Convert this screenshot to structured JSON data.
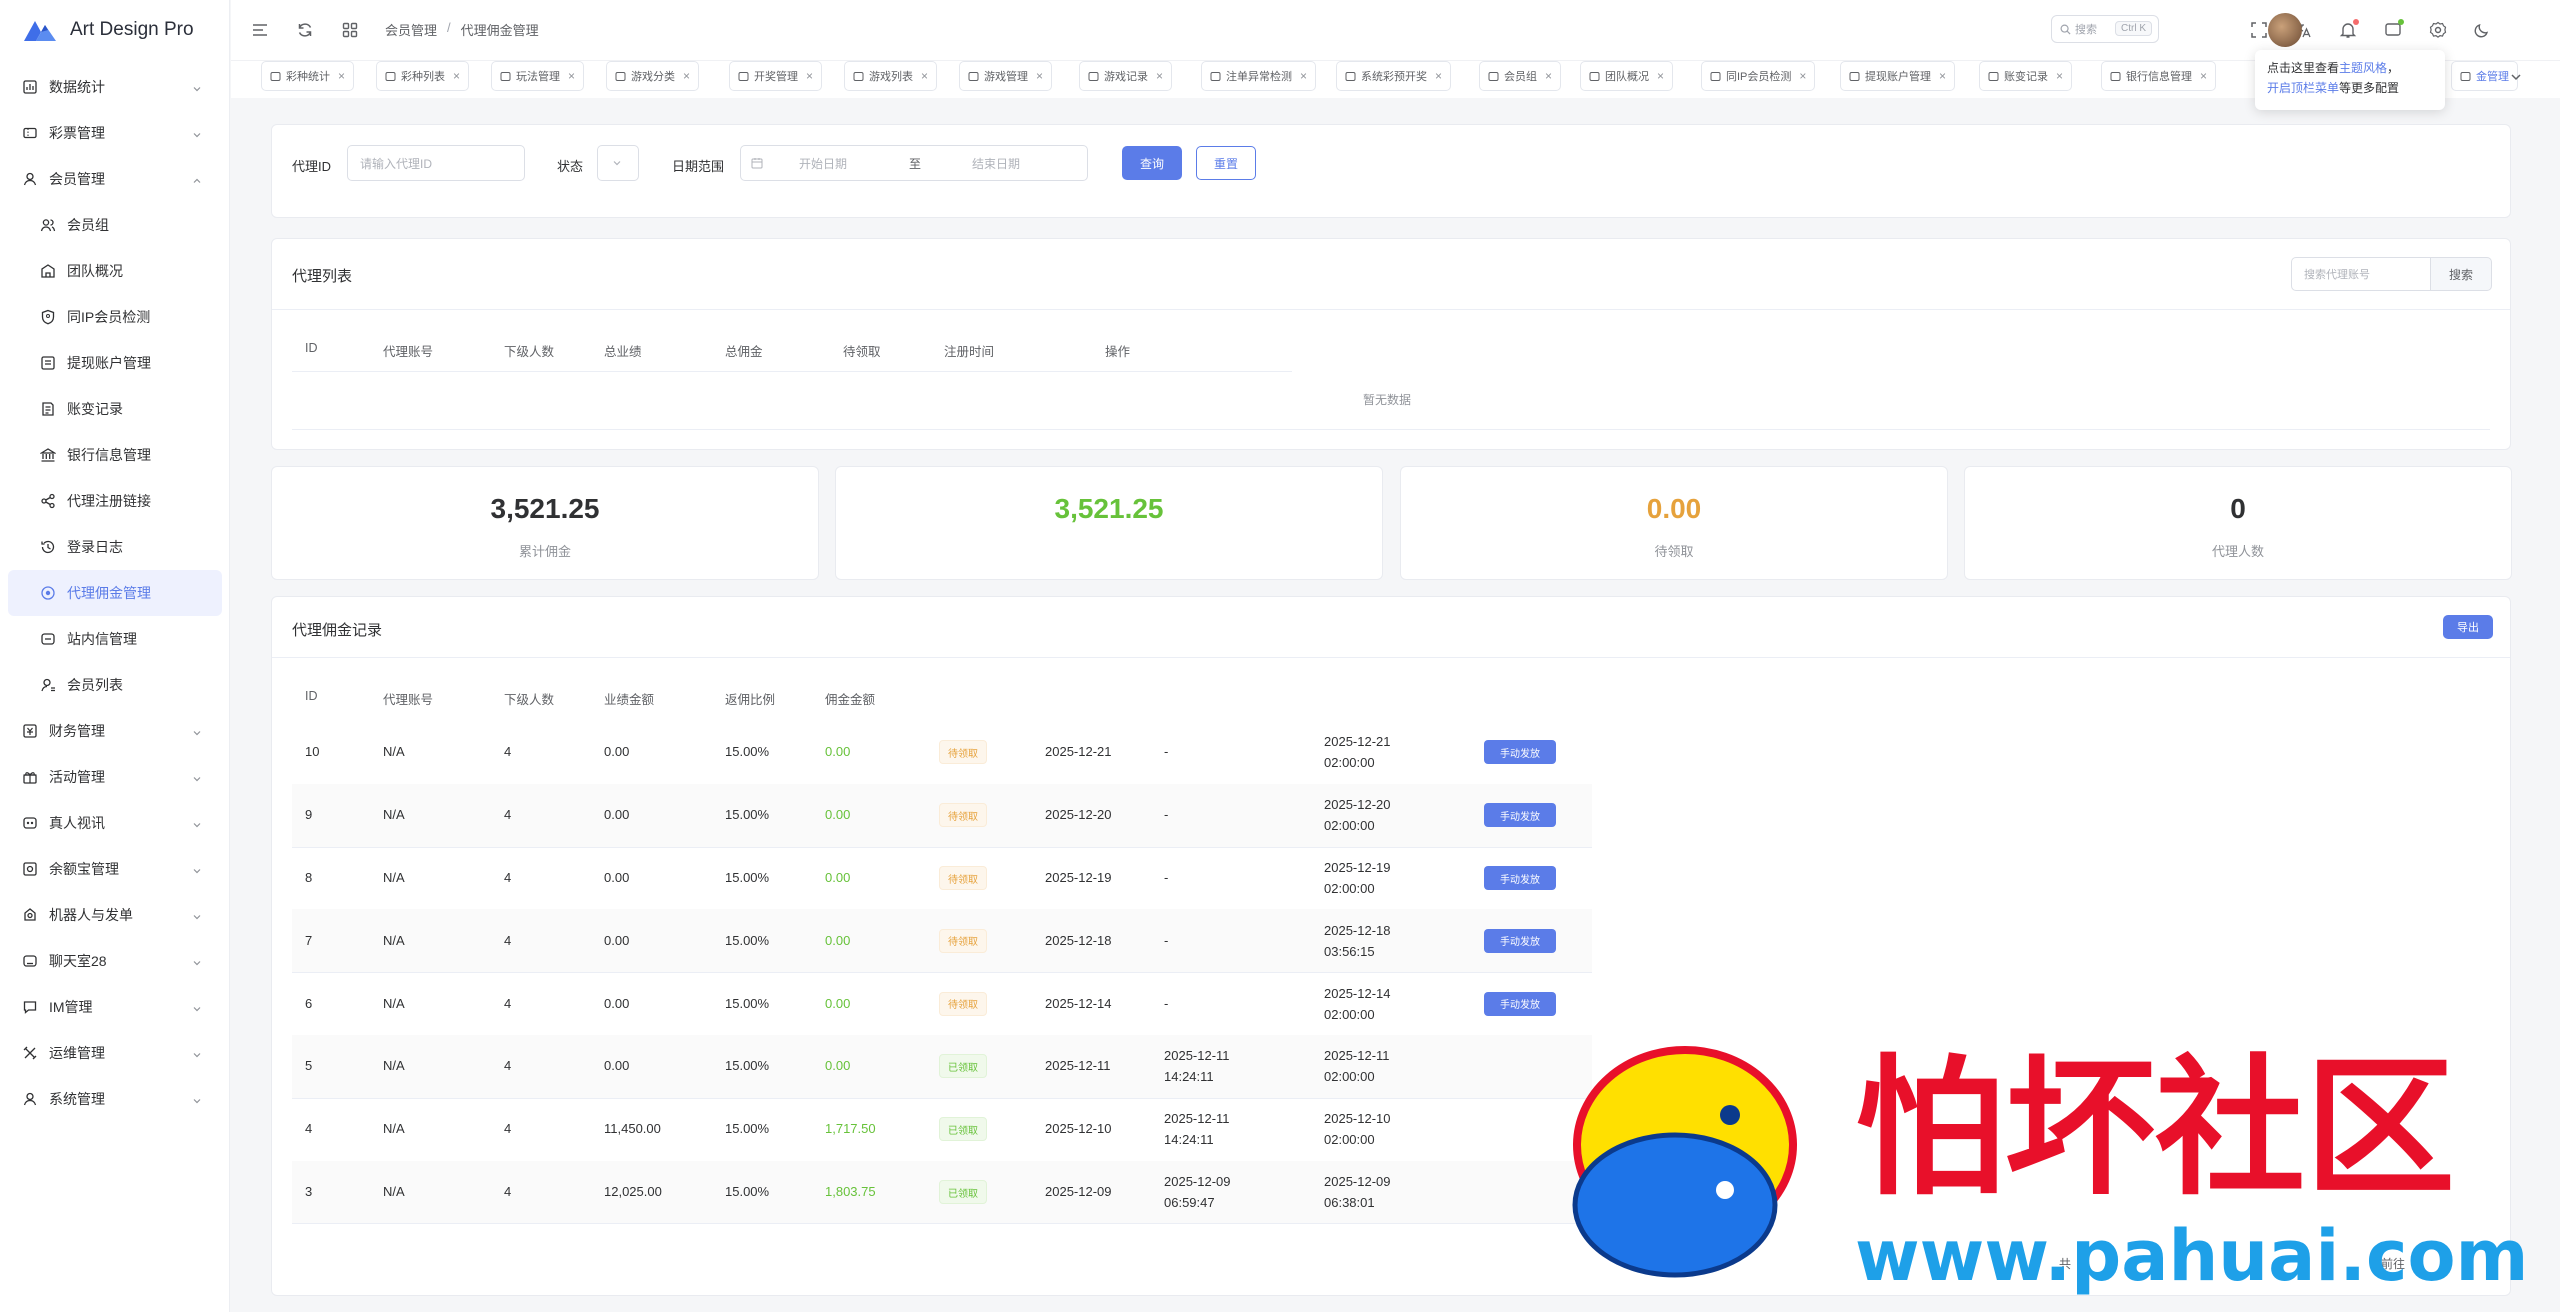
{
  "app": {
    "name": "Art Design Pro"
  },
  "sidebar": {
    "items": [
      {
        "label": "数据统计",
        "icon": "chart-icon",
        "kind": "top"
      },
      {
        "label": "彩票管理",
        "icon": "ticket-icon",
        "kind": "top"
      },
      {
        "label": "会员管理",
        "icon": "user-icon",
        "kind": "top-open"
      },
      {
        "label": "会员组",
        "icon": "users-icon",
        "kind": "sub"
      },
      {
        "label": "团队概况",
        "icon": "team-icon",
        "kind": "sub"
      },
      {
        "label": "同IP会员检测",
        "icon": "shield-icon",
        "kind": "sub"
      },
      {
        "label": "提现账户管理",
        "icon": "wallet-icon",
        "kind": "sub"
      },
      {
        "label": "账变记录",
        "icon": "record-icon",
        "kind": "sub"
      },
      {
        "label": "银行信息管理",
        "icon": "bank-icon",
        "kind": "sub"
      },
      {
        "label": "代理注册链接",
        "icon": "share-icon",
        "kind": "sub"
      },
      {
        "label": "登录日志",
        "icon": "history-icon",
        "kind": "sub"
      },
      {
        "label": "代理佣金管理",
        "icon": "commission-icon",
        "kind": "sub-active"
      },
      {
        "label": "站内信管理",
        "icon": "message-icon",
        "kind": "sub"
      },
      {
        "label": "会员列表",
        "icon": "user-list-icon",
        "kind": "sub"
      },
      {
        "label": "财务管理",
        "icon": "finance-icon",
        "kind": "top"
      },
      {
        "label": "活动管理",
        "icon": "gift-icon",
        "kind": "top"
      },
      {
        "label": "真人视讯",
        "icon": "video-icon",
        "kind": "top"
      },
      {
        "label": "余额宝管理",
        "icon": "coin-icon",
        "kind": "top"
      },
      {
        "label": "机器人与发单",
        "icon": "robot-icon",
        "kind": "top"
      },
      {
        "label": "聊天室28",
        "icon": "chat-icon",
        "kind": "top"
      },
      {
        "label": "IM管理",
        "icon": "im-icon",
        "kind": "top"
      },
      {
        "label": "运维管理",
        "icon": "tools-icon",
        "kind": "top"
      },
      {
        "label": "系统管理",
        "icon": "system-icon",
        "kind": "top"
      }
    ]
  },
  "header": {
    "breadcrumb": [
      "会员管理",
      "代理佣金管理"
    ],
    "breadcrumb_sep": "/",
    "search_placeholder": "搜索",
    "search_kbd": "Ctrl K"
  },
  "tabs": [
    {
      "label": "彩种统计"
    },
    {
      "label": "彩种列表"
    },
    {
      "label": "玩法管理"
    },
    {
      "label": "游戏分类"
    },
    {
      "label": "开奖管理"
    },
    {
      "label": "游戏列表"
    },
    {
      "label": "游戏管理"
    },
    {
      "label": "游戏记录"
    },
    {
      "label": "注单异常检测"
    },
    {
      "label": "系统彩预开奖"
    },
    {
      "label": "会员组"
    },
    {
      "label": "团队概况"
    },
    {
      "label": "同IP会员检测"
    },
    {
      "label": "提现账户管理"
    },
    {
      "label": "账变记录"
    },
    {
      "label": "银行信息管理"
    },
    {
      "label": "金管理"
    }
  ],
  "tab_close": "×",
  "tooltip": {
    "prefix": "点击这里查看",
    "link1": "主题风格",
    "mid": "，",
    "link2": "开启顶栏菜单",
    "suffix": "等更多配置"
  },
  "filter": {
    "agent_id_label": "代理ID",
    "agent_id_placeholder": "请输入代理ID",
    "status_label": "状态",
    "date_label": "日期范围",
    "start_placeholder": "开始日期",
    "range_sep": "至",
    "end_placeholder": "结束日期",
    "query_button": "查询",
    "reset_button": "重置"
  },
  "agent_list": {
    "title": "代理列表",
    "search_placeholder": "搜索代理账号",
    "search_button": "搜索",
    "columns": [
      "ID",
      "代理账号",
      "下级人数",
      "总业绩",
      "总佣金",
      "待领取",
      "注册时间",
      "操作"
    ],
    "empty": "暂无数据"
  },
  "stats": [
    {
      "value": "3,521.25",
      "label": "累计佣金",
      "color": "#303133"
    },
    {
      "value": "3,521.25",
      "label": "",
      "color": "#67c23a"
    },
    {
      "value": "0.00",
      "label": "待领取",
      "color": "#e6a23c"
    },
    {
      "value": "0",
      "label": "代理人数",
      "color": "#303133"
    }
  ],
  "records": {
    "title": "代理佣金记录",
    "export_button": "导出",
    "columns": [
      "ID",
      "代理账号",
      "下级人数",
      "业绩金额",
      "返佣比例",
      "佣金金额"
    ],
    "rows": [
      {
        "id": "10",
        "account": "N/A",
        "subs": "4",
        "amount": "0.00",
        "rate": "15.00%",
        "commission": "0.00",
        "status": "待领取",
        "status_type": "wait",
        "date": "2025-12-21",
        "claim1": "-",
        "claim2": "",
        "created1": "2025-12-21",
        "created2": "02:00:00",
        "action": "手动发放"
      },
      {
        "id": "9",
        "account": "N/A",
        "subs": "4",
        "amount": "0.00",
        "rate": "15.00%",
        "commission": "0.00",
        "status": "待领取",
        "status_type": "wait",
        "date": "2025-12-20",
        "claim1": "-",
        "claim2": "",
        "created1": "2025-12-20",
        "created2": "02:00:00",
        "action": "手动发放"
      },
      {
        "id": "8",
        "account": "N/A",
        "subs": "4",
        "amount": "0.00",
        "rate": "15.00%",
        "commission": "0.00",
        "status": "待领取",
        "status_type": "wait",
        "date": "2025-12-19",
        "claim1": "-",
        "claim2": "",
        "created1": "2025-12-19",
        "created2": "02:00:00",
        "action": "手动发放"
      },
      {
        "id": "7",
        "account": "N/A",
        "subs": "4",
        "amount": "0.00",
        "rate": "15.00%",
        "commission": "0.00",
        "status": "待领取",
        "status_type": "wait",
        "date": "2025-12-18",
        "claim1": "-",
        "claim2": "",
        "created1": "2025-12-18",
        "created2": "03:56:15",
        "action": "手动发放"
      },
      {
        "id": "6",
        "account": "N/A",
        "subs": "4",
        "amount": "0.00",
        "rate": "15.00%",
        "commission": "0.00",
        "status": "待领取",
        "status_type": "wait",
        "date": "2025-12-14",
        "claim1": "-",
        "claim2": "",
        "created1": "2025-12-14",
        "created2": "02:00:00",
        "action": "手动发放"
      },
      {
        "id": "5",
        "account": "N/A",
        "subs": "4",
        "amount": "0.00",
        "rate": "15.00%",
        "commission": "0.00",
        "status": "已领取",
        "status_type": "done",
        "date": "2025-12-11",
        "claim1": "2025-12-11",
        "claim2": "14:24:11",
        "created1": "2025-12-11",
        "created2": "02:00:00",
        "action": ""
      },
      {
        "id": "4",
        "account": "N/A",
        "subs": "4",
        "amount": "11,450.00",
        "rate": "15.00%",
        "commission": "1,717.50",
        "status": "已领取",
        "status_type": "done",
        "date": "2025-12-10",
        "claim1": "2025-12-11",
        "claim2": "14:24:11",
        "created1": "2025-12-10",
        "created2": "02:00:00",
        "action": ""
      },
      {
        "id": "3",
        "account": "N/A",
        "subs": "4",
        "amount": "12,025.00",
        "rate": "15.00%",
        "commission": "1,803.75",
        "status": "已领取",
        "status_type": "done",
        "date": "2025-12-09",
        "claim1": "2025-12-09",
        "claim2": "06:59:47",
        "created1": "2025-12-09",
        "created2": "06:38:01",
        "action": ""
      }
    ],
    "pager": {
      "total_prefix": "共",
      "goto": "前往"
    }
  },
  "watermark": {
    "cn": "怕坏社区",
    "url": "www.pahuai.com"
  },
  "colors": {
    "accent": "#5b7ce8",
    "success": "#67c23a",
    "warning": "#e6a23c",
    "watermark_red": "#e8102a",
    "watermark_blue": "#1ea0e8"
  }
}
